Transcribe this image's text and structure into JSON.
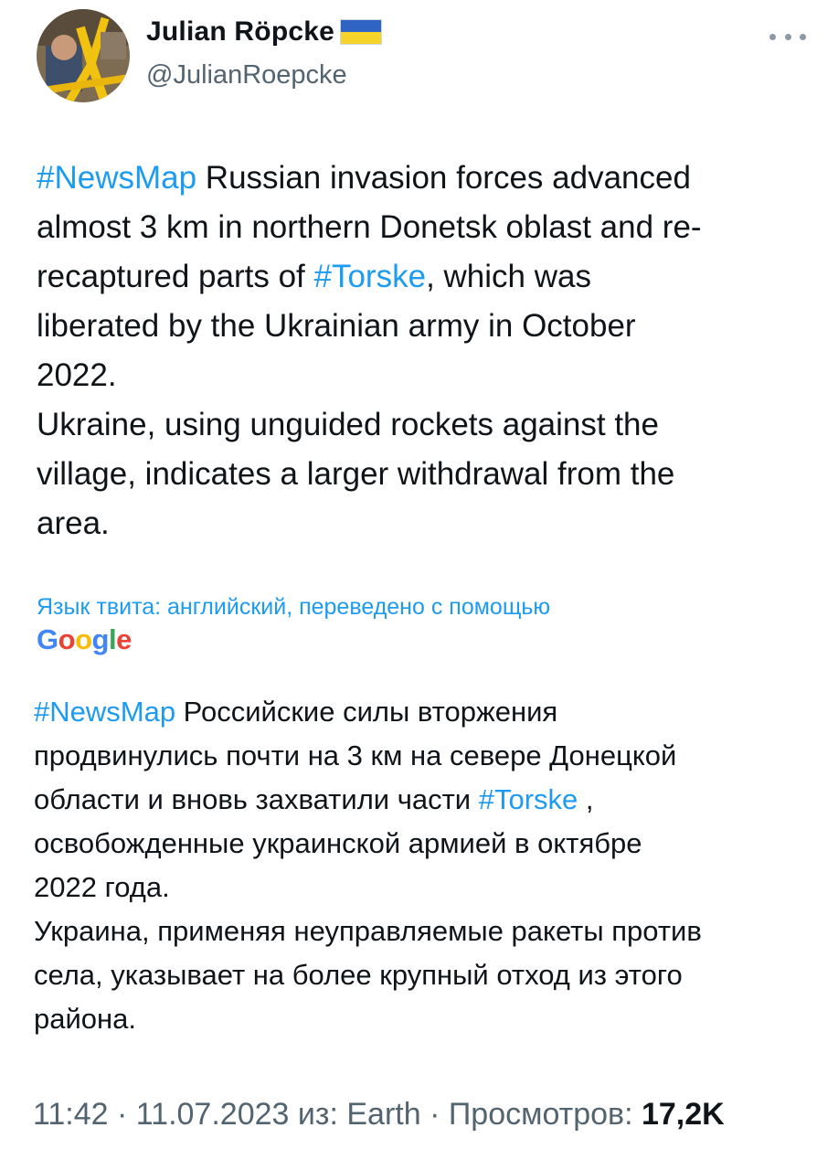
{
  "author": {
    "display_name": "Julian Röpcke",
    "flag_icon": "ukraine-flag-icon",
    "flag_colors": [
      "#2f63c4",
      "#f5d32b"
    ],
    "handle": "@JulianRoepcke"
  },
  "accent_color": "#1d9bf0",
  "tweet": {
    "hashtag_newsmap": "#NewsMap",
    "part1": " Russian invasion forces advanced\nalmost 3 km in northern Donetsk oblast and re-\nrecaptured parts of ",
    "hashtag_torske": "#Torske",
    "part2": ", which was\nliberated by the Ukrainian army in October\n2022.\nUkraine, using unguided rockets against the\nvillage, indicates a larger withdrawal from the\narea."
  },
  "translation": {
    "note": "Язык твита: английский, переведено с помощью",
    "logo_text": "Google",
    "hashtag_newsmap": "#NewsMap",
    "part1": " Российские силы вторжения\nпродвинулись почти на 3 км на севере Донецкой\nобласти и вновь захватили части ",
    "hashtag_torske": "#Torske",
    "part2": " ,\nосвобожденные украинской армией в октябре\n2022 года.\nУкраина, применяя неуправляемые ракеты против\nсела, указывает на более крупный отход из этого\nрайона."
  },
  "meta": {
    "time": "11:42",
    "sep1": " · ",
    "date": "11.07.2023",
    "source": " из: Earth",
    "sep2": " · ",
    "views_label": "Просмотров: ",
    "views_count": "17,2K"
  }
}
